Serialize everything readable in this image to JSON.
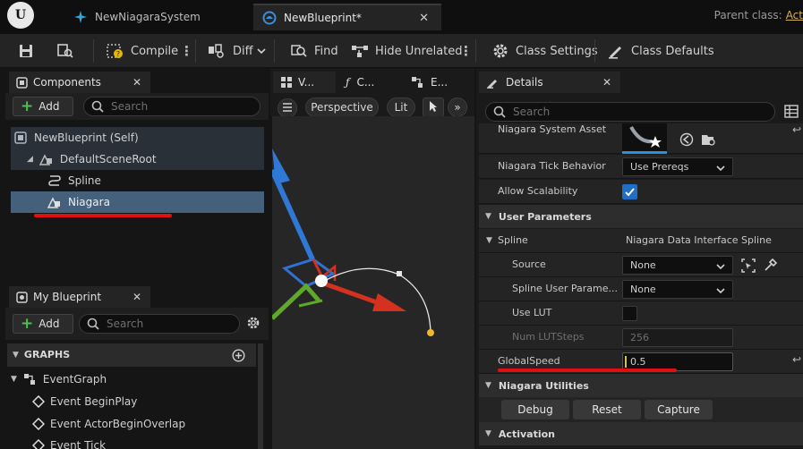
{
  "tabs": [
    {
      "label": "NewNiagaraSystem",
      "icon": "niagara-system-icon",
      "active": false
    },
    {
      "label": "NewBlueprint*",
      "icon": "blueprint-icon",
      "active": true
    }
  ],
  "parent_class": {
    "label": "Parent class:",
    "value": "Act"
  },
  "toolbar": {
    "compile": "Compile",
    "diff": "Diff",
    "find": "Find",
    "hide_unrelated": "Hide Unrelated",
    "class_settings": "Class Settings",
    "class_defaults": "Class Defaults"
  },
  "components": {
    "title": "Components",
    "add": "Add",
    "search_placeholder": "Search",
    "items": [
      "NewBlueprint (Self)",
      "DefaultSceneRoot",
      "Spline",
      "Niagara"
    ]
  },
  "my_blueprint": {
    "title": "My Blueprint",
    "add": "Add",
    "search_placeholder": "Search",
    "graphs_label": "GRAPHS",
    "items": [
      "EventGraph",
      "Event BeginPlay",
      "Event ActorBeginOverlap",
      "Event Tick"
    ]
  },
  "center_tabs": [
    "V...",
    "C...",
    "E..."
  ],
  "viewport": {
    "perspective": "Perspective",
    "lit": "Lit"
  },
  "details": {
    "title": "Details",
    "search_placeholder": "Search",
    "rows": {
      "system_asset": "Niagara System Asset",
      "tick_behavior": "Niagara Tick Behavior",
      "tick_behavior_value": "Use Prereqs",
      "allow_scalability": "Allow Scalability",
      "user_parameters": "User Parameters",
      "spline": "Spline",
      "spline_value": "Niagara Data Interface Spline",
      "source": "Source",
      "source_value": "None",
      "spline_user_param": "Spline User Parame...",
      "spline_user_param_value": "None",
      "use_lut": "Use LUT",
      "num_lut_steps": "Num LUTSteps",
      "num_lut_steps_value": "256",
      "global_speed": "GlobalSpeed",
      "global_speed_value": "0.5",
      "niagara_utilities": "Niagara Utilities",
      "debug": "Debug",
      "reset": "Reset",
      "capture": "Capture",
      "activation": "Activation"
    }
  },
  "colors": {
    "accent_blue": "#1e88e5",
    "annotation_red": "#e01010",
    "selection": "#45607a",
    "checkbox_blue": "#1f6fc5"
  }
}
